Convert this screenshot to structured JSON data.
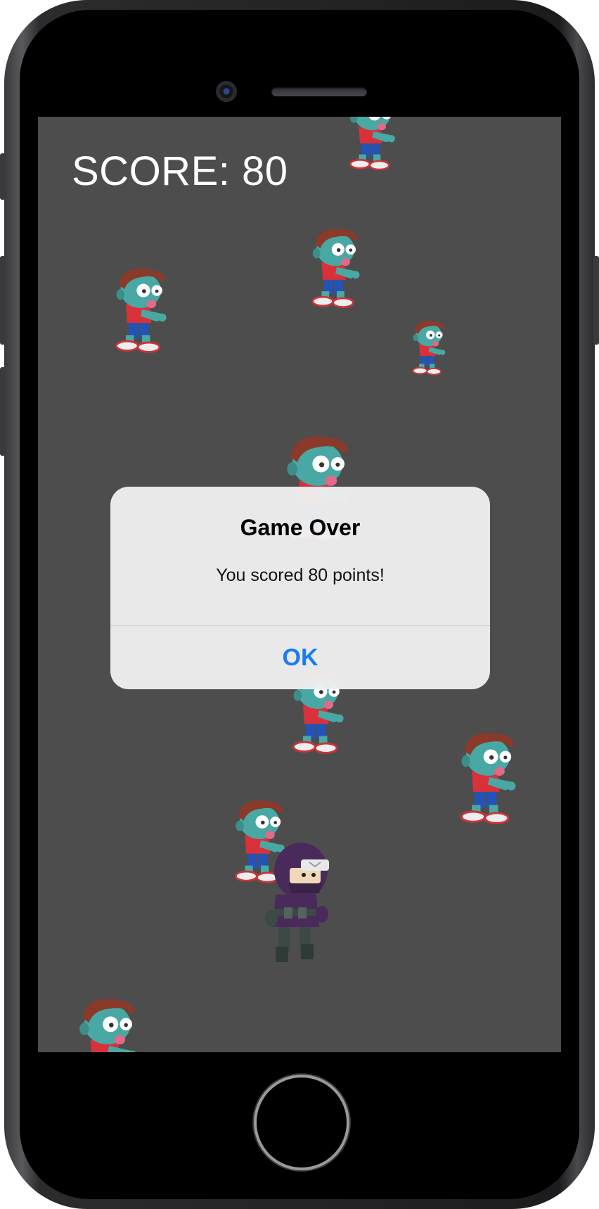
{
  "game": {
    "score_text": "SCORE: 80"
  },
  "alert": {
    "title": "Game Over",
    "message": "You scored 80 points!",
    "ok_label": "OK"
  },
  "colors": {
    "background": "#4d4d4d",
    "accent": "#1a7cf5"
  }
}
